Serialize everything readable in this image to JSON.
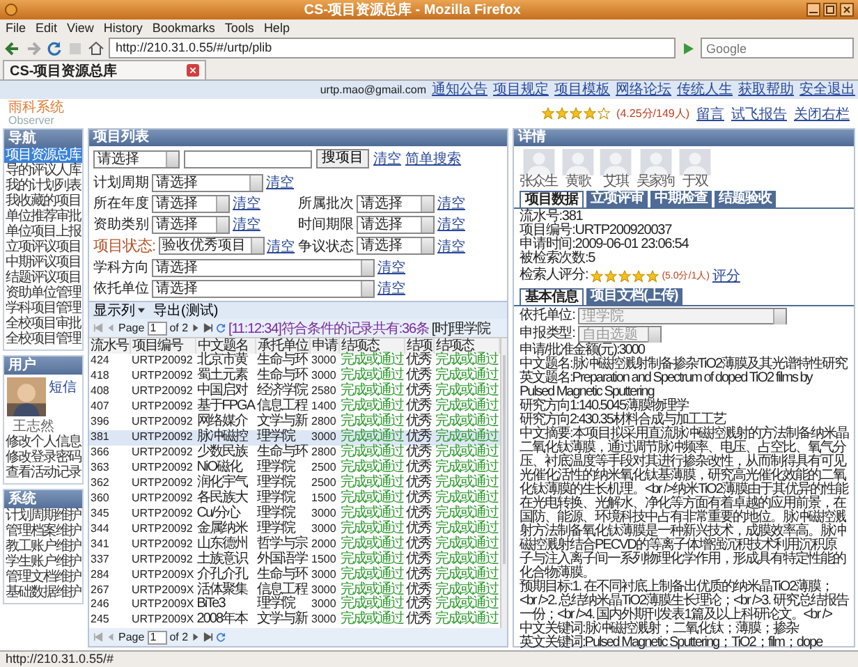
{
  "window": {
    "title": "CS-项目资源总库 - Mozilla Firefox"
  },
  "menu": [
    "File",
    "Edit",
    "View",
    "History",
    "Bookmarks",
    "Tools",
    "Help"
  ],
  "address": "http://210.31.0.55/#/urtp/plib",
  "search": {
    "placeholder": "Google"
  },
  "tabs": [
    {
      "label": "CS-项目资源总库",
      "selected": true
    }
  ],
  "top_links": {
    "email": "urtp.mao@gmail.com",
    "links": [
      "通知公告",
      "项目规定",
      "项目模板",
      "网络论坛",
      "传统人生",
      "获取帮助",
      "安全退出"
    ]
  },
  "logo": {
    "title": "雨科系统",
    "subtitle": "Observer"
  },
  "rating": {
    "stars": 4,
    "text": "(4.25分/149人)",
    "links": [
      "留言",
      "试飞报告",
      "关闭右栏"
    ]
  },
  "sidebar": {
    "nav": {
      "title": "导航",
      "items": [
        {
          "label": "项目资源总库",
          "selected": true
        },
        {
          "label": "导的评议人库",
          "selected": false
        },
        {
          "label": "我的计划列表",
          "selected": false
        },
        {
          "label": "我收藏的项目",
          "selected": false
        },
        {
          "label": "单位推荐审批",
          "selected": false
        },
        {
          "label": "单位项目上报",
          "selected": false
        },
        {
          "label": "立项评议项目",
          "selected": false
        },
        {
          "label": "中期评议项目",
          "selected": false
        },
        {
          "label": "结题评议项目",
          "selected": false
        },
        {
          "label": "资助单位管理",
          "selected": false
        },
        {
          "label": "学科项目管理",
          "selected": false
        },
        {
          "label": "全校项目审批",
          "selected": false
        },
        {
          "label": "全校项目管理",
          "selected": false
        }
      ]
    },
    "user": {
      "title": "用户",
      "link": "短信",
      "name": "王志然",
      "items": [
        "修改个人信息",
        "修改登录密码",
        "查看活动记录"
      ]
    },
    "system": {
      "title": "系统",
      "items": [
        "计划周期维护",
        "管理档案维护",
        "教工账户维护",
        "学生账户维护",
        "管理文档维护",
        "基础数据维护"
      ]
    }
  },
  "project_list": {
    "title": "项目列表",
    "search": {
      "field": "请选择",
      "button": "搜项目",
      "links": [
        "清空",
        "简单搜索"
      ]
    },
    "filters": [
      [
        {
          "label": "计划周期",
          "value": "请选择",
          "clear": "清空",
          "emphasized": false
        }
      ],
      [
        {
          "label": "所在年度",
          "value": "请选择",
          "clear": "清空",
          "emphasized": false
        },
        {
          "label": "所属批次",
          "value": "请选择",
          "clear": "清空",
          "emphasized": false
        }
      ],
      [
        {
          "label": "资助类别",
          "value": "请选择",
          "clear": "清空",
          "emphasized": false
        },
        {
          "label": "时间期限",
          "value": "请选择",
          "clear": "清空",
          "emphasized": false
        }
      ],
      [
        {
          "label": "项目状态:",
          "value": "验收优秀项目",
          "clear": "清空",
          "emphasized": true
        },
        {
          "label": "争议状态",
          "value": "请选择",
          "clear": "清空",
          "emphasized": false
        }
      ],
      [
        {
          "label": "学科方向",
          "value": "请选择",
          "clear": "清空",
          "emphasized": false
        }
      ],
      [
        {
          "label": "依托单位",
          "value": "请选择",
          "clear": "清空",
          "emphasized": false
        }
      ]
    ],
    "toolbar": [
      "显示列",
      "导出(测试)"
    ],
    "pager": {
      "label": "Page",
      "page": "1",
      "of": "of 2",
      "status": "[11:12:34]符合条件的记录共有:36条",
      "scope": "[时]理学院"
    },
    "columns": [
      "流水号",
      "项目编号",
      "中文题名",
      "承托单位",
      "申请",
      "结项态",
      "结项",
      "结项态"
    ],
    "rows": [
      {
        "cells": [
          "424",
          "URTP20092",
          "北京市黄",
          "生命与环",
          "3000",
          "完成或通过",
          "优秀",
          "完成或通过"
        ],
        "selected": false
      },
      {
        "cells": [
          "418",
          "URTP20092",
          "蜀土元素",
          "生命与环",
          "3000",
          "完成或通过",
          "优秀",
          "完成或通过"
        ],
        "selected": false
      },
      {
        "cells": [
          "408",
          "URTP20092",
          "中国启对",
          "经济学院",
          "2580",
          "完成或通过",
          "优秀",
          "完成或通过"
        ],
        "selected": false
      },
      {
        "cells": [
          "407",
          "URTP20092",
          "基于FPGA",
          "信息工程",
          "1400",
          "完成或通过",
          "优秀",
          "完成或通过"
        ],
        "selected": false
      },
      {
        "cells": [
          "396",
          "URTP20092",
          "网络媒介",
          "文学与新",
          "2800",
          "完成或通过",
          "优秀",
          "完成或通过"
        ],
        "selected": false
      },
      {
        "cells": [
          "381",
          "URTP20092",
          "脉冲磁控",
          "理学院",
          "3000",
          "完成或通过",
          "优秀",
          "完成或通过"
        ],
        "selected": true
      },
      {
        "cells": [
          "366",
          "URTP20092",
          "少数民族",
          "生命与环",
          "2800",
          "完成或通过",
          "优秀",
          "完成或通过"
        ],
        "selected": false
      },
      {
        "cells": [
          "363",
          "URTP20092",
          "NiO磁化",
          "理学院",
          "2500",
          "完成或通过",
          "优秀",
          "完成或通过"
        ],
        "selected": false
      },
      {
        "cells": [
          "362",
          "URTP20092",
          "润化宇气",
          "理学院",
          "2500",
          "完成或通过",
          "优秀",
          "完成或通过"
        ],
        "selected": false
      },
      {
        "cells": [
          "360",
          "URTP20092",
          "各民族大",
          "理学院",
          "1500",
          "完成或通过",
          "优秀",
          "完成或通过"
        ],
        "selected": false
      },
      {
        "cells": [
          "345",
          "URTP20092",
          "Cu/分心",
          "理学院",
          "3000",
          "完成或通过",
          "优秀",
          "完成或通过"
        ],
        "selected": false
      },
      {
        "cells": [
          "344",
          "URTP20092",
          "金属纳米",
          "理学院",
          "3000",
          "完成或通过",
          "优秀",
          "完成或通过"
        ],
        "selected": false
      },
      {
        "cells": [
          "341",
          "URTP20092",
          "山东德州",
          "哲学与宗",
          "2000",
          "完成或通过",
          "优秀",
          "完成或通过"
        ],
        "selected": false
      },
      {
        "cells": [
          "337",
          "URTP20092",
          "土族意识",
          "外国语学",
          "1500",
          "完成或通过",
          "优秀",
          "完成或通过"
        ],
        "selected": false
      },
      {
        "cells": [
          "284",
          "URTP2009X",
          "介孔介孔",
          "生命与环",
          "3000",
          "完成或通过",
          "优秀",
          "完成或通过"
        ],
        "selected": false
      },
      {
        "cells": [
          "267",
          "URTP2009X",
          "活体聚集",
          "信息工程",
          "3000",
          "完成或通过",
          "优秀",
          "完成或通过"
        ],
        "selected": false
      },
      {
        "cells": [
          "246",
          "URTP2009X",
          "BiTe3",
          "理学院",
          "3000",
          "完成或通过",
          "优秀",
          "完成或通过"
        ],
        "selected": false
      },
      {
        "cells": [
          "245",
          "URTP2009X",
          "2008年本",
          "文学与新",
          "3000",
          "完成或通过",
          "优秀",
          "完成或通过"
        ],
        "selected": false
      }
    ],
    "bottom_pager": {
      "label": "Page",
      "page": "1",
      "of": "of 2"
    }
  },
  "detail": {
    "title": "详情",
    "people": [
      "张众生",
      "黄歌",
      "艾琪",
      "吴家驹",
      "于双"
    ],
    "tabs": [
      {
        "label": "项目数据",
        "selected": true
      },
      {
        "label": "立项评审",
        "selected": false
      },
      {
        "label": "中期检查",
        "selected": false
      },
      {
        "label": "结题验收",
        "selected": false
      }
    ],
    "info": [
      "流水号:381",
      "项目编号:URTP200920037",
      "申请时间:2009-06-01 23:06:54",
      "被检索次数:5"
    ],
    "score": {
      "label": "检索人评分:",
      "stars": 5,
      "text": "(5.0分/1人)",
      "link": "评分"
    },
    "subtabs": [
      {
        "label": "基本信息",
        "selected": true
      },
      {
        "label": "项目文档(上传)",
        "selected": false
      }
    ],
    "selects": [
      {
        "label": "依托单位:",
        "value": "理学院"
      },
      {
        "label": "申报类型:",
        "value": "自由选题"
      }
    ],
    "paragraphs": [
      "申请/批准金额(元):3000",
      "中文题名:脉冲磁控溅射制备掺杂TiO2薄膜及其光谱特性研究",
      "英文题名:Preparation and Spectrum of doped TiO2 films by Pulsed Magnetic Sputtering",
      "研究方向1:140.5045薄膜物理学",
      "研究方向2:430.35材料合成与加工工艺",
      "中文摘要:本项目拟采用直流脉冲磁控溅射的方法制备纳米晶二氧化钛薄膜，通过调节脉冲频率、电压、占空比、氧气分压、衬底温度等手段对其进行掺杂改性，从而制得具有可见光催化活性的纳米氧化钛基薄膜，研究高光催化效能的二氧化钛薄膜的生长机理。<br />纳米TiO2薄膜由于其优异的性能在光电转换、光解水、净化等方面有着卓越的应用前景，在国防、能源、环境科技中占有非常重要的地位。脉冲磁控溅射方法制备氧化钛薄膜是一种新兴技术，成膜效率高。脉冲磁控溅射结合PECVD的等离子体增强沉积技术利用沉积原子与注入离子间一系列物理化学作用，形成具有特定性能的化合物薄膜。",
      "预期目标:1. 在不同衬底上制备出优质的纳米晶TiO2薄膜；<br />2. 总结纳米晶TiO2薄膜生长理论；<br />3. 研究总结报告一份；<br />4. 国内外期刊发表1篇及以上科研论文。<br />",
      "中文关键词:脉冲磁控溅射；二氧化钛；薄膜；掺杂",
      "英文关键词:Pulsed Magnetic Sputtering；TiO2；film；dope"
    ]
  },
  "status_bar": "http://210.31.0.55/#"
}
